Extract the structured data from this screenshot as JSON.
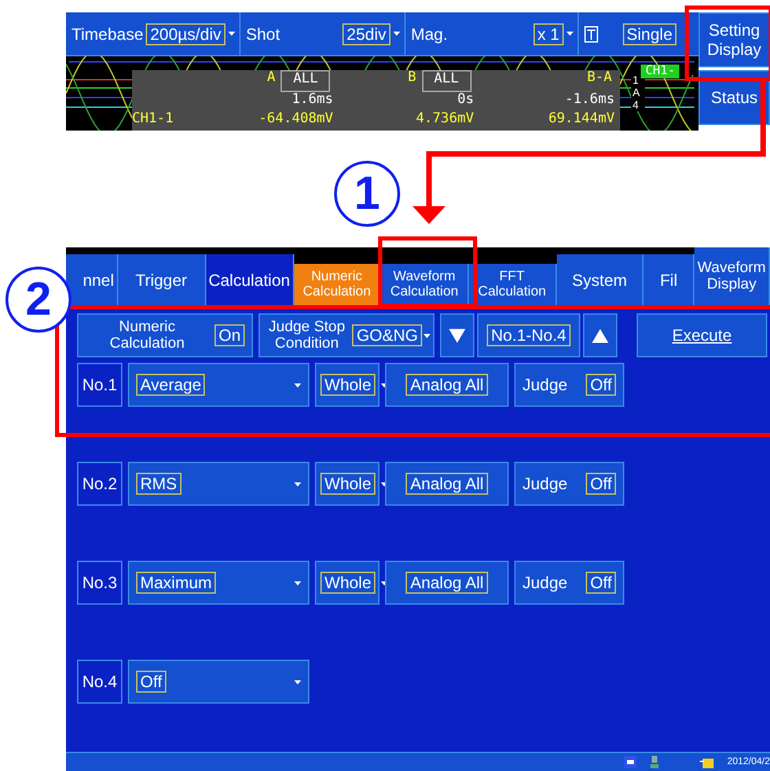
{
  "top_screen": {
    "header": {
      "timebase": {
        "label": "Timebase",
        "value": "200µs/div"
      },
      "shot": {
        "label": "Shot",
        "value": "25div"
      },
      "mag": {
        "label": "Mag.",
        "value": "x 1"
      },
      "mode": {
        "value": "Single"
      }
    },
    "side_buttons": [
      {
        "label": "Setting Display"
      },
      {
        "label": "Status"
      }
    ],
    "scope": {
      "cursor_a": {
        "label": "A",
        "range": "ALL",
        "time": "1.6ms",
        "value": "-64.408mV"
      },
      "cursor_b": {
        "label": "B",
        "range": "ALL",
        "time": "0s",
        "value": "4.736mV"
      },
      "difference": {
        "label": "B-A",
        "time": "-1.6ms",
        "value": "69.144mV"
      },
      "channel": "CH1-1",
      "channel_tag": "CH1-",
      "scale_marker": "1A4"
    }
  },
  "callouts": [
    {
      "label": "1"
    },
    {
      "label": "2"
    }
  ],
  "bottom_screen": {
    "tabs": [
      {
        "label": "nnel",
        "kind": "main",
        "selected": false
      },
      {
        "label": "Trigger",
        "kind": "main",
        "selected": false
      },
      {
        "label": "Calculation",
        "kind": "main",
        "selected": true
      },
      {
        "label": "Numeric Calculation",
        "kind": "sub",
        "selected": true
      },
      {
        "label": "Waveform Calculation",
        "kind": "sub",
        "selected": false
      },
      {
        "label": "FFT Calculation",
        "kind": "sub",
        "selected": false
      },
      {
        "label": "System",
        "kind": "main",
        "selected": false
      },
      {
        "label": "Fil",
        "kind": "main",
        "selected": false
      },
      {
        "label": "Waveform Display",
        "kind": "button"
      }
    ],
    "settings": {
      "numeric_calculation": {
        "label": "Numeric Calculation",
        "value": "On"
      },
      "judge_stop": {
        "label": "Judge Stop Condition",
        "value": "GO&NG"
      },
      "range": "No.1-No.4",
      "execute": "Execute"
    },
    "calculations": [
      {
        "number": "No.1",
        "function": "Average",
        "range": "Whole",
        "channel": "Analog All",
        "judge_label": "Judge",
        "judge": "Off"
      },
      {
        "number": "No.2",
        "function": "RMS",
        "range": "Whole",
        "channel": "Analog All",
        "judge_label": "Judge",
        "judge": "Off"
      },
      {
        "number": "No.3",
        "function": "Maximum",
        "range": "Whole",
        "channel": "Analog All",
        "judge_label": "Judge",
        "judge": "Off"
      },
      {
        "number": "No.4",
        "function": "Off"
      }
    ],
    "status_bar": {
      "date": "2012/04/2"
    }
  }
}
